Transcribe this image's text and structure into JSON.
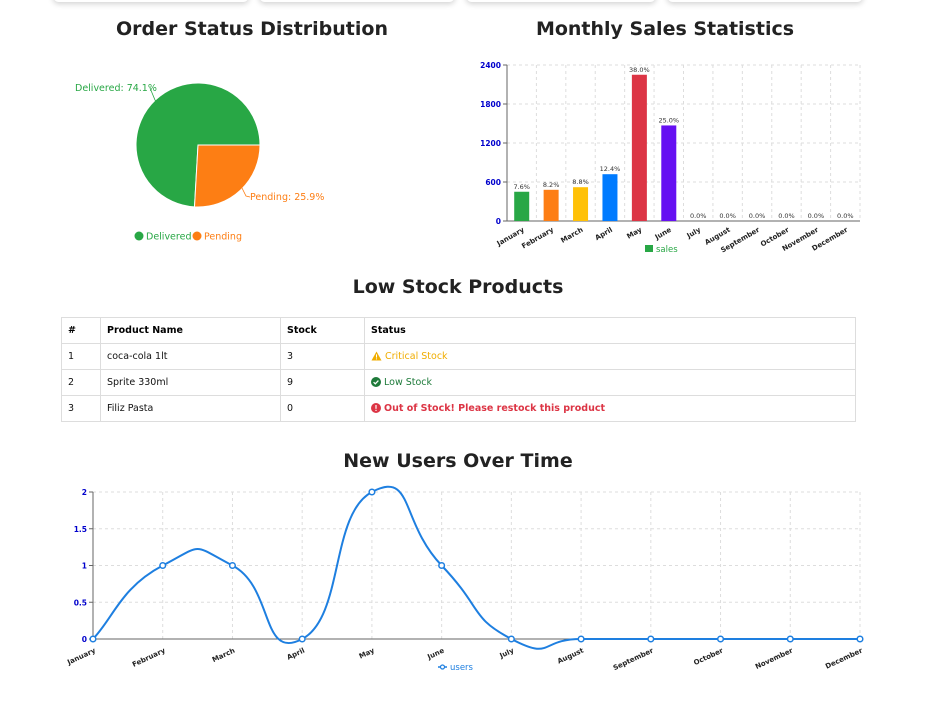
{
  "pie": {
    "title": "Order Status Distribution",
    "chart_data": {
      "type": "pie",
      "title": "Order Status Distribution",
      "slices": [
        {
          "name": "Delivered",
          "value": 74.1,
          "label": "Delivered: 74.1%",
          "color": "#28a745"
        },
        {
          "name": "Pending",
          "value": 25.9,
          "label": "Pending: 25.9%",
          "color": "#fd7e14"
        }
      ],
      "legend": [
        "Delivered",
        "Pending"
      ],
      "legend_position": "bottom"
    }
  },
  "bar": {
    "title": "Monthly Sales Statistics",
    "chart_data": {
      "type": "bar",
      "title": "Monthly Sales Statistics",
      "categories": [
        "January",
        "February",
        "March",
        "April",
        "May",
        "June",
        "July",
        "August",
        "September",
        "October",
        "November",
        "December"
      ],
      "values": [
        450,
        480,
        520,
        720,
        2250,
        1470,
        0,
        0,
        0,
        0,
        0,
        0
      ],
      "data_labels": [
        "7.6%",
        "8.2%",
        "8.8%",
        "12.4%",
        "38.0%",
        "25.0%",
        "0.0%",
        "0.0%",
        "0.0%",
        "0.0%",
        "0.0%",
        "0.0%"
      ],
      "colors": [
        "#28a745",
        "#fd7e14",
        "#ffc107",
        "#007bff",
        "#dc3545",
        "#6610f2"
      ],
      "series_name": "sales",
      "legend_color": "#28a745",
      "yticks": [
        0,
        600,
        1200,
        1800,
        2400
      ],
      "ylim": [
        0,
        2400
      ],
      "grid": true,
      "legend_position": "bottom"
    }
  },
  "table": {
    "title": "Low Stock Products",
    "headers": [
      "#",
      "Product Name",
      "Stock",
      "Status"
    ],
    "rows": [
      {
        "num": "1",
        "name": "coca-cola 1lt",
        "stock": "3",
        "status": "Critical Stock",
        "icon": "warning-icon"
      },
      {
        "num": "2",
        "name": "Sprite 330ml",
        "stock": "9",
        "status": "Low Stock",
        "icon": "check-circle-icon"
      },
      {
        "num": "3",
        "name": "Filiz Pasta",
        "stock": "0",
        "status": "Out of Stock! Please restock this product",
        "icon": "exclamation-circle-icon"
      }
    ]
  },
  "line": {
    "title": "New Users Over Time",
    "chart_data": {
      "type": "line",
      "title": "New Users Over Time",
      "x": [
        "January",
        "February",
        "March",
        "April",
        "May",
        "June",
        "July",
        "August",
        "September",
        "October",
        "November",
        "December"
      ],
      "series": [
        {
          "name": "users",
          "values": [
            0,
            1,
            1,
            0,
            2,
            1,
            0,
            0,
            0,
            0,
            0,
            0
          ],
          "color": "#1e7fe0"
        }
      ],
      "yticks": [
        "0",
        "0.5",
        "1",
        "1.5",
        "2"
      ],
      "ylim": [
        0,
        2
      ],
      "grid": true,
      "legend_position": "bottom"
    }
  }
}
